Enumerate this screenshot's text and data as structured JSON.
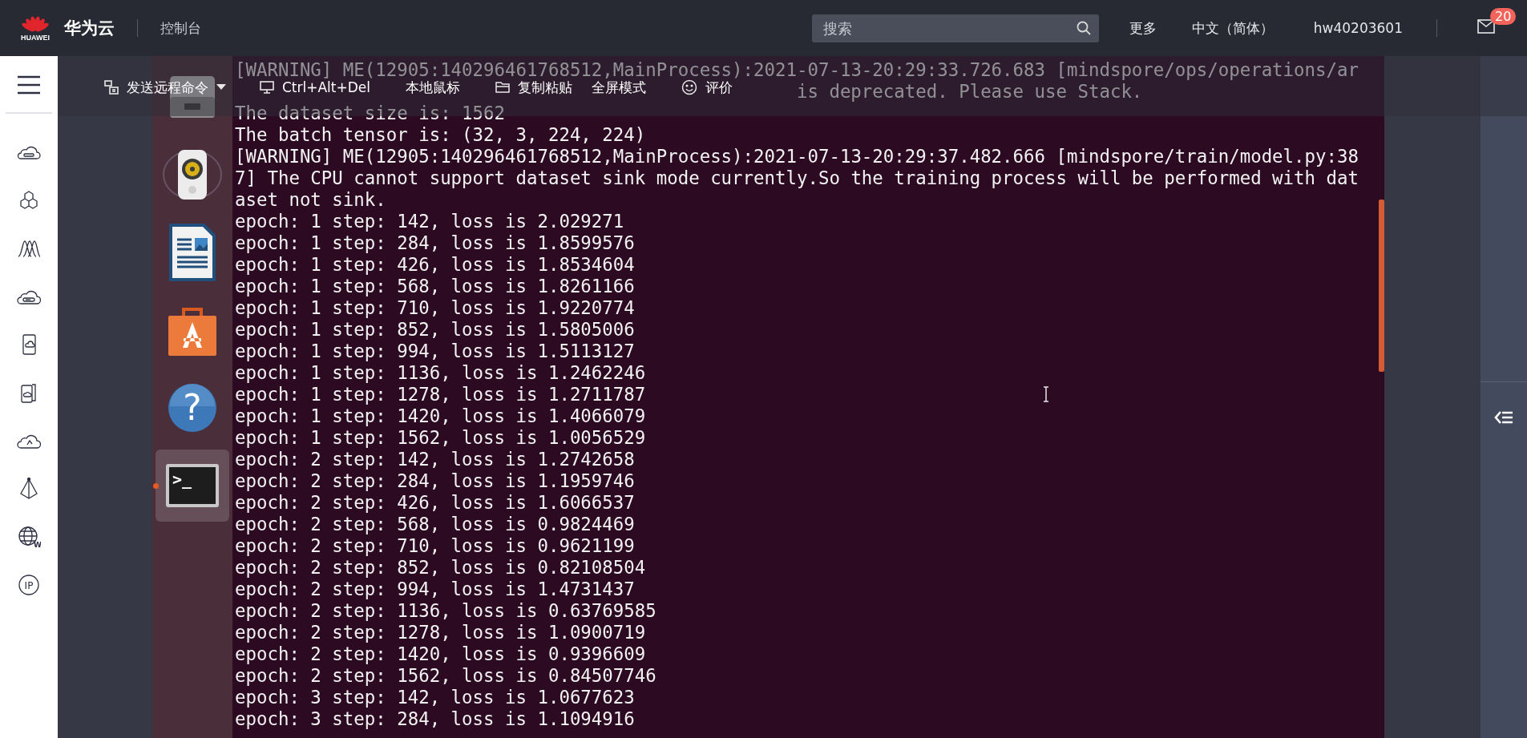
{
  "header": {
    "logo_text": "HUAWEI",
    "brand": "华为云",
    "console": "控制台",
    "search": {
      "placeholder": "搜索"
    },
    "links": [
      "更多",
      "中文（简体）",
      "hw40203601"
    ],
    "mail_badge": "20"
  },
  "toolbar": [
    {
      "kind": "send",
      "label": "发送远程命令"
    },
    {
      "kind": "monitor",
      "label": "Ctrl+Alt+Del"
    },
    {
      "kind": "plain",
      "label": "本地鼠标"
    },
    {
      "kind": "folder",
      "label": "复制粘贴"
    },
    {
      "kind": "plain",
      "label": "全屏模式"
    },
    {
      "kind": "smiley",
      "label": "评价"
    }
  ],
  "sidebar": {
    "items": [
      {
        "kind": "cloud-server"
      },
      {
        "kind": "hexagons"
      },
      {
        "kind": "waves"
      },
      {
        "kind": "cloud-drive"
      },
      {
        "kind": "card"
      },
      {
        "kind": "cards"
      },
      {
        "kind": "cloud-gauge"
      },
      {
        "kind": "pyramid"
      },
      {
        "kind": "globe",
        "label": "W"
      },
      {
        "kind": "badge",
        "label": "IP"
      }
    ]
  },
  "dock": [
    {
      "kind": "drive",
      "active": false
    },
    {
      "kind": "speaker",
      "active": false
    },
    {
      "kind": "document",
      "active": false
    },
    {
      "kind": "store",
      "active": false
    },
    {
      "kind": "help",
      "label": "?",
      "active": false
    },
    {
      "kind": "terminal",
      "label": ">_",
      "active": true
    }
  ],
  "terminal": {
    "lines": [
      "[WARNING] ME(12905:140296461768512,MainProcess):2021-07-13-20:29:33.726.683 [mindspore/ops/operations/ar",
      "is deprecated. Please use Stack.",
      "The dataset size is: 1562",
      "The batch tensor is: (32, 3, 224, 224)",
      "[WARNING] ME(12905:140296461768512,MainProcess):2021-07-13-20:29:37.482.666 [mindspore/train/model.py:38",
      "7] The CPU cannot support dataset sink mode currently.So the training process will be performed with dat",
      "aset not sink.",
      "epoch: 1 step: 142, loss is 2.029271",
      "epoch: 1 step: 284, loss is 1.8599576",
      "epoch: 1 step: 426, loss is 1.8534604",
      "epoch: 1 step: 568, loss is 1.8261166",
      "epoch: 1 step: 710, loss is 1.9220774",
      "epoch: 1 step: 852, loss is 1.5805006",
      "epoch: 1 step: 994, loss is 1.5113127",
      "epoch: 1 step: 1136, loss is 1.2462246",
      "epoch: 1 step: 1278, loss is 1.2711787",
      "epoch: 1 step: 1420, loss is 1.4066079",
      "epoch: 1 step: 1562, loss is 1.0056529",
      "epoch: 2 step: 142, loss is 1.2742658",
      "epoch: 2 step: 284, loss is 1.1959746",
      "epoch: 2 step: 426, loss is 1.6066537",
      "epoch: 2 step: 568, loss is 0.9824469",
      "epoch: 2 step: 710, loss is 0.9621199",
      "epoch: 2 step: 852, loss is 0.82108504",
      "epoch: 2 step: 994, loss is 1.4731437",
      "epoch: 2 step: 1136, loss is 0.63769585",
      "epoch: 2 step: 1278, loss is 1.0900719",
      "epoch: 2 step: 1420, loss is 0.9396609",
      "epoch: 2 step: 1562, loss is 0.84507746",
      "epoch: 3 step: 142, loss is 1.0677623",
      "epoch: 3 step: 284, loss is 1.1094916"
    ]
  }
}
